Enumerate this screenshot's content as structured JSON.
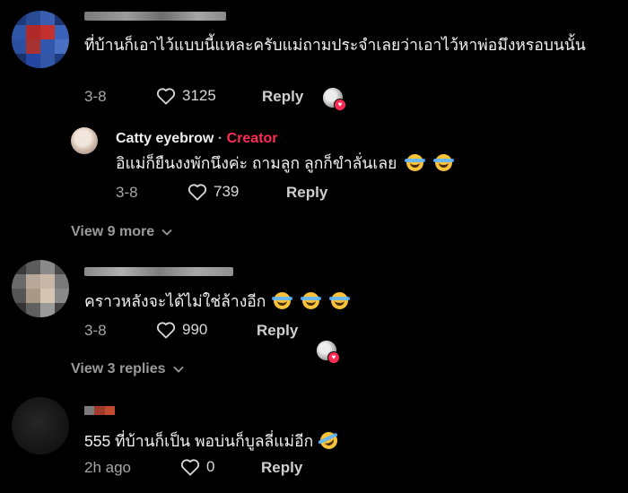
{
  "colors": {
    "background": "#000000",
    "creator_accent": "#fe2c55",
    "meta_text": "#a6a6a6"
  },
  "comments": [
    {
      "text": "ที่บ้านก็เอาไว้แบบนี้แหละครับแม่ถามประจำเลยว่าเอาไว้หาพ่อมึงหรอบนนั้น",
      "date": "3-8",
      "likes": "3125",
      "reply_label": "Reply",
      "creator_liked": true,
      "reply": {
        "author": "Catty eyebrow",
        "separator": "·",
        "badge": "Creator",
        "text": "อิแม่ก็ยืนงงพักนึงค่ะ ถามลูก ลูกก็ขำลั่นเลย",
        "date": "3-8",
        "likes": "739",
        "reply_label": "Reply"
      },
      "view_more": "View 9 more"
    },
    {
      "text": "คราวหลังจะได้ไม่ใช่ล้างอีก",
      "date": "3-8",
      "likes": "990",
      "reply_label": "Reply",
      "creator_liked": true,
      "view_more": "View 3 replies"
    },
    {
      "text": "555 ที่บ้านก็เป็น พอบ่นก็บูลลี่แม่อีก",
      "date": "2h ago",
      "likes": "0",
      "reply_label": "Reply",
      "creator_liked": false
    }
  ],
  "icons": {
    "heart": "heart-outline-icon",
    "chevron": "chevron-down-icon",
    "laugh_emoji": "face-with-tears-of-joy-emoji",
    "rofl_emoji": "rolling-on-floor-laughing-emoji"
  }
}
